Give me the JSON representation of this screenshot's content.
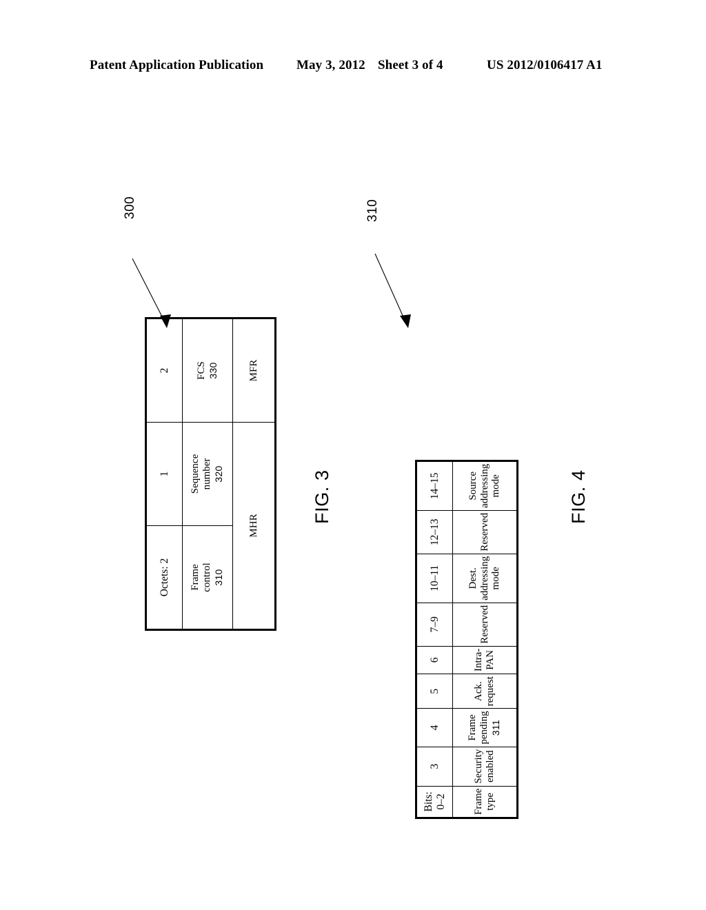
{
  "header": {
    "publication": "Patent Application Publication",
    "date": "May 3, 2012",
    "sheet": "Sheet 3 of 4",
    "doc_id": "US 2012/0106417 A1"
  },
  "figures": [
    {
      "id": "fig3",
      "caption": "FIG. 3",
      "reference_numeral": "300",
      "columns": [
        {
          "size_label": "Octets: 2",
          "field_label": "Frame\ncontrol",
          "field_ref": "310"
        },
        {
          "size_label": "1",
          "field_label": "Sequence\nnumber",
          "field_ref": "320"
        },
        {
          "size_label": "2",
          "field_label": "FCS",
          "field_ref": "330"
        }
      ],
      "group_row": [
        {
          "label": "MHR",
          "span": 2
        },
        {
          "label": "MFR",
          "span": 1
        }
      ]
    },
    {
      "id": "fig4",
      "caption": "FIG. 4",
      "reference_numeral": "310",
      "columns": [
        {
          "size_label": "Bits: 0–2",
          "field_label": "Frame\ntype",
          "field_ref": ""
        },
        {
          "size_label": "3",
          "field_label": "Security\nenabled",
          "field_ref": ""
        },
        {
          "size_label": "4",
          "field_label": "Frame\npending",
          "field_ref": "311"
        },
        {
          "size_label": "5",
          "field_label": "Ack.\nrequest",
          "field_ref": ""
        },
        {
          "size_label": "6",
          "field_label": "Intra-\nPAN",
          "field_ref": ""
        },
        {
          "size_label": "7–9",
          "field_label": "Reserved",
          "field_ref": ""
        },
        {
          "size_label": "10–11",
          "field_label": "Dest.\naddressing\nmode",
          "field_ref": ""
        },
        {
          "size_label": "12–13",
          "field_label": "Reserved",
          "field_ref": ""
        },
        {
          "size_label": "14–15",
          "field_label": "Source\naddressing\nmode",
          "field_ref": ""
        }
      ],
      "group_row": []
    }
  ]
}
